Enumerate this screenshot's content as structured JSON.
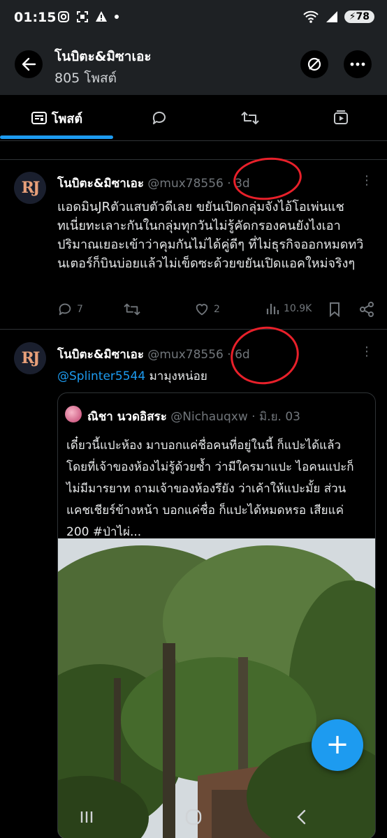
{
  "status_bar": {
    "time": "01:15",
    "left_icons": [
      "instagram-icon",
      "screenshot-icon",
      "warning-icon",
      "dot"
    ],
    "battery": "78",
    "right_icons": [
      "wifi-icon",
      "signal-icon",
      "battery-icon"
    ]
  },
  "header": {
    "title": "โนบิตะ&มิซาเอะ",
    "subtitle": "805 โพสต์",
    "back_icon": "arrow-left-icon",
    "right_icons": [
      "hide-icon",
      "more-horizontal-icon"
    ]
  },
  "tabs": [
    {
      "label": "โพสต์",
      "icon": "posts-icon",
      "active": true
    },
    {
      "label": "",
      "icon": "reply-icon",
      "active": false
    },
    {
      "label": "",
      "icon": "repost-icon",
      "active": false
    },
    {
      "label": "",
      "icon": "media-icon",
      "active": false
    }
  ],
  "posts": [
    {
      "avatar_text": "RJ",
      "name": "โนบิตะ&มิซาเอะ",
      "handle": "@mux78556",
      "time": "3d",
      "text": "แอดมินJRตัวแสบตัวดีเลย ขยันเปิดกลุ่มจังไอ้โอเพ่นแชทเนี่ยทะเลาะกันในกลุ่มทุกวันไม่รู้คัดกรองคนยังไงเอาปริมาณเยอะเข้าว่าคุมกันไม่ได้คู่ดีๆ ที่ไม่ธุรกิจออกหมดทวินเตอร์ก็บินบ่อยแล้วไม่เข็ดซะด้วยขยันเปิดแอคใหม่จริงๆ",
      "replies": "7",
      "reposts": "",
      "likes": "2",
      "views": "10.9K"
    },
    {
      "avatar_text": "RJ",
      "name": "โนบิตะ&มิซาเอะ",
      "handle": "@mux78556",
      "time": "6d",
      "reply_mention": "@Splinter5544",
      "reply_text": "มามุงหน่อย",
      "quote": {
        "name": "ณิชา นวดอิสระ",
        "handle": "@Nichauqxw",
        "date": "มิ.ย. 03",
        "text": "เดี๋ยวนี้แปะห้อง มาบอกแค่ชื่อคนที่อยู่ในนี้ ก็แปะได้แล้ว โดยที่เจ้าของห้องไม่รู้ด้วยซ้ำ ว่ามีใครมาแปะ ไอคนแปะก็ไม่มีมารยาท ถามเจ้าของห้องรึยัง ว่าเค้าให้แปะมั้ย ส่วนแคชเชียร์ข้างหน้า บอกแค่ชื่อ ก็แปะได้หมดหรอ เสียแค่ 200 #ป่าไผ่..."
      }
    }
  ],
  "fab": {
    "icon": "plus-icon",
    "label": "+"
  },
  "nav_bar": {
    "icons": [
      "recent-apps-icon",
      "home-icon",
      "back-icon"
    ]
  },
  "colors": {
    "accent": "#1d9bf0",
    "background": "#000000",
    "header_bg": "#1e2124",
    "muted_text": "#71767b",
    "annotation": "#e8202a"
  }
}
